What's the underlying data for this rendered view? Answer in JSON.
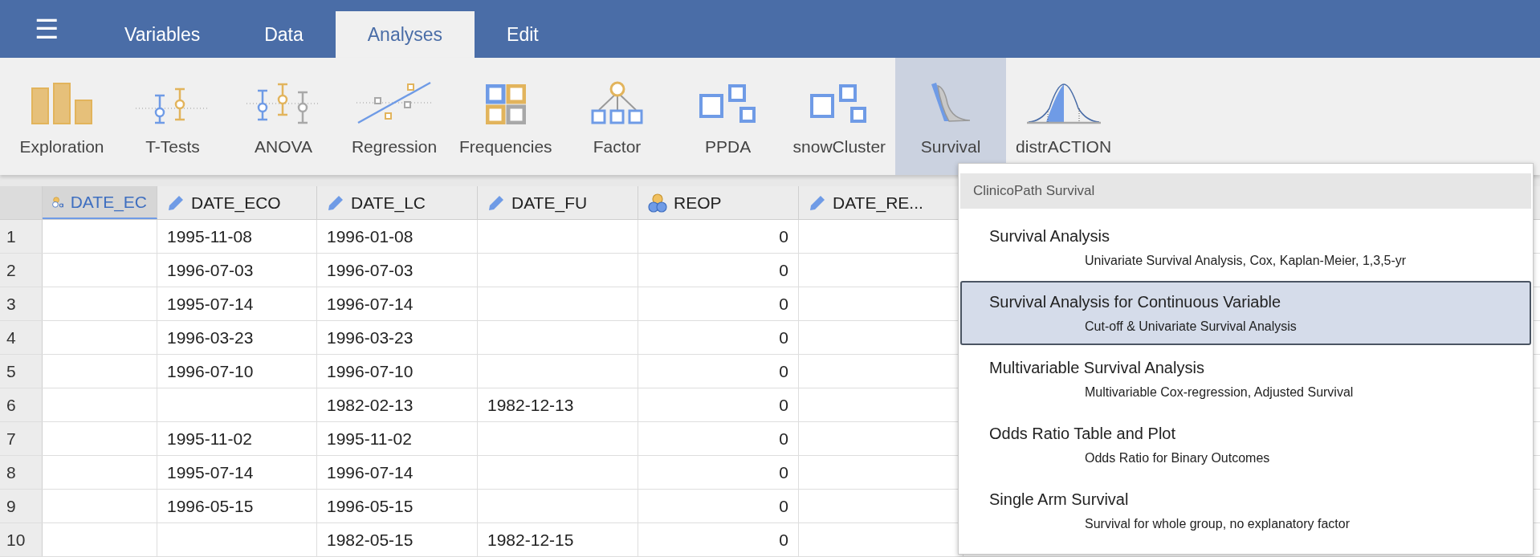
{
  "menu_button": "☰",
  "tabs": [
    {
      "label": "Variables",
      "selected": false
    },
    {
      "label": "Data",
      "selected": false
    },
    {
      "label": "Analyses",
      "selected": true
    },
    {
      "label": "Edit",
      "selected": false
    }
  ],
  "tools": [
    {
      "label": "Exploration",
      "kind": "bars",
      "selected": false
    },
    {
      "label": "T-Tests",
      "kind": "ttest",
      "selected": false
    },
    {
      "label": "ANOVA",
      "kind": "anova",
      "selected": false
    },
    {
      "label": "Regression",
      "kind": "regression",
      "selected": false
    },
    {
      "label": "Frequencies",
      "kind": "grid",
      "selected": false
    },
    {
      "label": "Factor",
      "kind": "tree",
      "selected": false
    },
    {
      "label": "PPDA",
      "kind": "squares",
      "selected": false
    },
    {
      "label": "snowCluster",
      "kind": "squares",
      "selected": false
    },
    {
      "label": "Survival",
      "kind": "survival",
      "selected": true
    },
    {
      "label": "distrACTION",
      "kind": "distribution",
      "selected": false
    }
  ],
  "table": {
    "columns": [
      {
        "name": "DATE_EC",
        "kind": "nominal_text",
        "selected": true
      },
      {
        "name": "DATE_ECO",
        "kind": "pencil",
        "selected": false
      },
      {
        "name": "DATE_LC",
        "kind": "pencil",
        "selected": false
      },
      {
        "name": "DATE_FU",
        "kind": "pencil",
        "selected": false
      },
      {
        "name": "REOP",
        "kind": "nominal",
        "selected": false
      },
      {
        "name": "DATE_RE...",
        "kind": "pencil",
        "selected": false
      }
    ],
    "rows": [
      {
        "number": "1",
        "cells": [
          null,
          "1995-11-08",
          "1996-01-08",
          null,
          "0",
          null
        ]
      },
      {
        "number": "2",
        "cells": [
          null,
          "1996-07-03",
          "1996-07-03",
          null,
          "0",
          null
        ]
      },
      {
        "number": "3",
        "cells": [
          null,
          "1995-07-14",
          "1996-07-14",
          null,
          "0",
          null
        ]
      },
      {
        "number": "4",
        "cells": [
          null,
          "1996-03-23",
          "1996-03-23",
          null,
          "0",
          null
        ]
      },
      {
        "number": "5",
        "cells": [
          null,
          "1996-07-10",
          "1996-07-10",
          null,
          "0",
          null
        ]
      },
      {
        "number": "6",
        "cells": [
          null,
          null,
          "1982-02-13",
          "1982-12-13",
          "0",
          null
        ]
      },
      {
        "number": "7",
        "cells": [
          null,
          "1995-11-02",
          "1995-11-02",
          null,
          "0",
          null
        ]
      },
      {
        "number": "8",
        "cells": [
          null,
          "1995-07-14",
          "1996-07-14",
          null,
          "0",
          null
        ]
      },
      {
        "number": "9",
        "cells": [
          null,
          "1996-05-15",
          "1996-05-15",
          null,
          "0",
          null
        ]
      },
      {
        "number": "10",
        "cells": [
          null,
          null,
          "1982-05-15",
          "1982-12-15",
          "0",
          null
        ]
      }
    ]
  },
  "menu": {
    "heading": "ClinicoPath Survival",
    "items": [
      {
        "title": "Survival Analysis",
        "description": "Univariate Survival Analysis, Cox, Kaplan-Meier, 1,3,5-yr",
        "selected": false
      },
      {
        "title": "Survival Analysis for Continuous Variable",
        "description": "Cut-off & Univariate Survival Analysis",
        "selected": true
      },
      {
        "title": "Multivariable Survival Analysis",
        "description": "Multivariable Cox-regression, Adjusted Survival",
        "selected": false
      },
      {
        "title": "Odds Ratio Table and Plot",
        "description": "Odds Ratio for Binary Outcomes",
        "selected": false
      },
      {
        "title": "Single Arm Survival",
        "description": "Survival for whole group, no explanatory factor",
        "selected": false
      }
    ]
  }
}
